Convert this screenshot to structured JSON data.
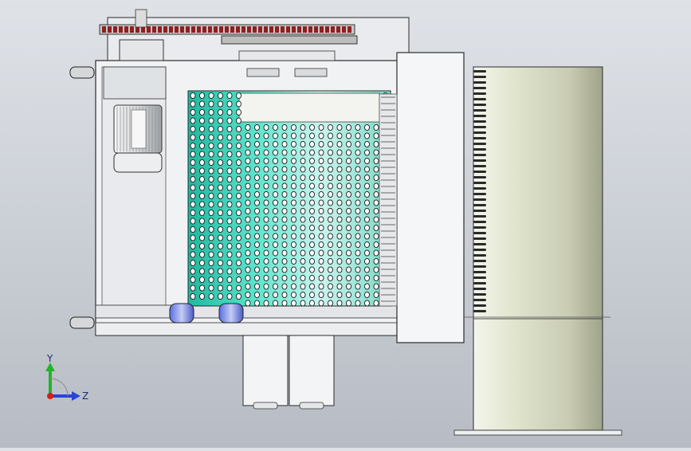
{
  "viewport": {
    "background_top": "#dfe3e8",
    "background_bottom": "#b7bcc4"
  },
  "model": {
    "drum_color": "#3fd2b8",
    "frame_color": "#eef0f2",
    "line_color": "#2b2b2b",
    "cylinder_color": "#dde0c8"
  },
  "triad": {
    "y_label": "Y",
    "z_label": "Z",
    "y_color": "#1fb52a",
    "z_color": "#2a45d8",
    "x_color": "#d81e1e"
  }
}
